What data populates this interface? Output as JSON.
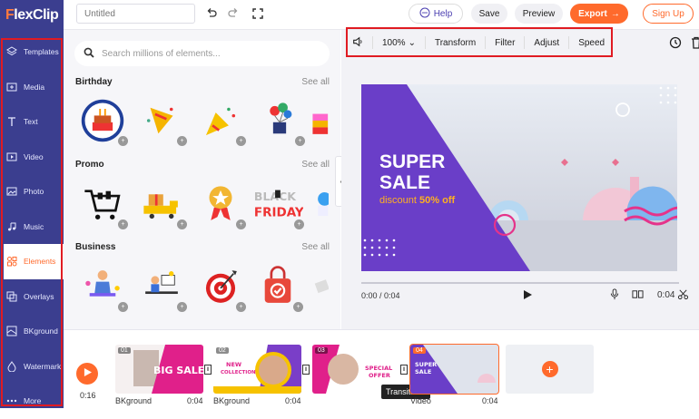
{
  "app": {
    "logo_rest": "lexClip"
  },
  "sidebar": {
    "items": [
      {
        "label": "Templates",
        "icon": "layers-icon"
      },
      {
        "label": "Media",
        "icon": "media-icon"
      },
      {
        "label": "Text",
        "icon": "text-icon"
      },
      {
        "label": "Video",
        "icon": "video-icon"
      },
      {
        "label": "Photo",
        "icon": "photo-icon"
      },
      {
        "label": "Music",
        "icon": "music-icon"
      },
      {
        "label": "Elements",
        "icon": "elements-icon"
      },
      {
        "label": "Overlays",
        "icon": "overlays-icon"
      },
      {
        "label": "BKground",
        "icon": "background-icon"
      },
      {
        "label": "Watermark",
        "icon": "watermark-icon"
      },
      {
        "label": "More",
        "icon": "more-icon"
      }
    ],
    "active": "Elements"
  },
  "topbar": {
    "title_placeholder": "Untitled",
    "help": "Help",
    "save": "Save",
    "preview": "Preview",
    "export": "Export",
    "signup": "Sign Up"
  },
  "panel": {
    "search_placeholder": "Search millions of elements...",
    "see_all": "See all",
    "sections": [
      {
        "title": "Birthday"
      },
      {
        "title": "Promo"
      },
      {
        "title": "Business"
      }
    ]
  },
  "preview_toolbar": {
    "zoom": "100%",
    "transform": "Transform",
    "filter": "Filter",
    "adjust": "Adjust",
    "speed": "Speed"
  },
  "canvas": {
    "line1": "SUPER",
    "line2": "SALE",
    "discount": "discount",
    "discount_value": "50% off"
  },
  "player": {
    "current": "0:00 / 0:04",
    "duration": "0:04"
  },
  "timeline": {
    "total": "0:16",
    "clips": [
      {
        "num": "01",
        "label": "BKground",
        "duration": "0:04",
        "title": "BIG SALE"
      },
      {
        "num": "02",
        "label": "BKground",
        "duration": "0:04",
        "title": "NEW COLLECTION"
      },
      {
        "num": "03",
        "label": "",
        "duration": "",
        "title": "SPECIAL OFFER"
      },
      {
        "num": "04",
        "label": "Video",
        "duration": "0:04",
        "title": "SUPER SALE"
      }
    ],
    "tooltip": "Transitions"
  },
  "colors": {
    "accent": "#ff6a2c",
    "sidebar": "#3b3e8f",
    "slide_purple": "#6a3ec8",
    "highlight": "#e01b22"
  }
}
